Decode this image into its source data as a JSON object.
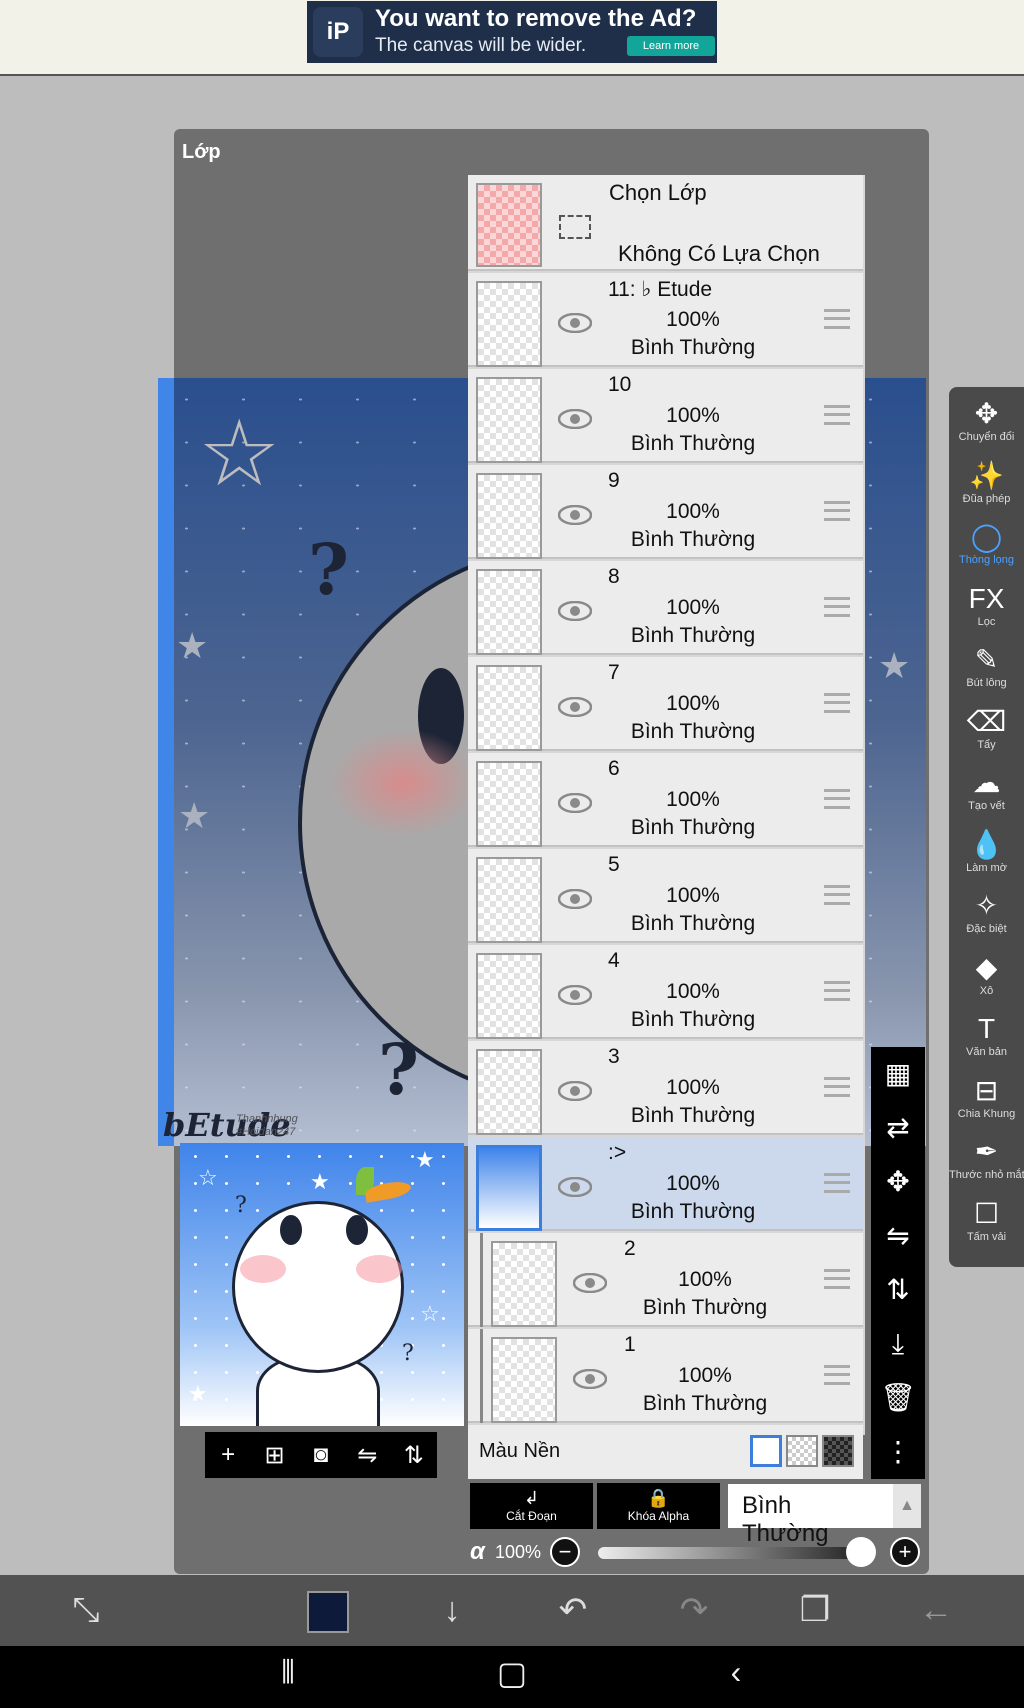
{
  "ad": {
    "line1": "You want to remove the Ad?",
    "line2": "The canvas will be wider.",
    "learn_more": "Learn more",
    "logo_text": "iP"
  },
  "panel": {
    "title": "Lớp"
  },
  "canvas": {
    "signature": "bEtude",
    "credit_line1": "Thanhnhung",
    "credit_line2": "#Hoidan247"
  },
  "selection_layer": {
    "title": "Chọn Lớp",
    "status": "Không Có Lựa Chọn"
  },
  "layers": [
    {
      "name": "11: ♭ Etude",
      "opacity": "100%",
      "mode": "Bình Thường"
    },
    {
      "name": "10",
      "opacity": "100%",
      "mode": "Bình Thường"
    },
    {
      "name": "9",
      "opacity": "100%",
      "mode": "Bình Thường"
    },
    {
      "name": "8",
      "opacity": "100%",
      "mode": "Bình Thường"
    },
    {
      "name": "7",
      "opacity": "100%",
      "mode": "Bình Thường"
    },
    {
      "name": "6",
      "opacity": "100%",
      "mode": "Bình Thường"
    },
    {
      "name": "5",
      "opacity": "100%",
      "mode": "Bình Thường"
    },
    {
      "name": "4",
      "opacity": "100%",
      "mode": "Bình Thường"
    },
    {
      "name": "3",
      "opacity": "100%",
      "mode": "Bình Thường"
    },
    {
      "name": ":>",
      "opacity": "100%",
      "mode": "Bình Thường",
      "selected": true
    },
    {
      "name": "2",
      "opacity": "100%",
      "mode": "Bình Thường"
    },
    {
      "name": "1",
      "opacity": "100%",
      "mode": "Bình Thường"
    }
  ],
  "background_row": {
    "label": "Màu Nền"
  },
  "blend": {
    "clip_label": "Cắt Đoạn",
    "alpha_lock_label": "Khóa Alpha",
    "mode": "Bình Thường"
  },
  "alpha": {
    "symbol": "α",
    "value": "100%"
  },
  "tools": [
    {
      "label": "Chuyển đổi",
      "icon": "move-icon"
    },
    {
      "label": "Đũa phép",
      "icon": "magic-wand-icon"
    },
    {
      "label": "Thòng lọng",
      "icon": "lasso-icon",
      "active": true
    },
    {
      "label": "Lọc",
      "icon": "fx-icon"
    },
    {
      "label": "Bút lông",
      "icon": "brush-icon"
    },
    {
      "label": "Tẩy",
      "icon": "eraser-icon"
    },
    {
      "label": "Tạo vết",
      "icon": "smudge-icon"
    },
    {
      "label": "Làm mờ",
      "icon": "blur-icon"
    },
    {
      "label": "Đặc biệt",
      "icon": "special-icon"
    },
    {
      "label": "Xô",
      "icon": "bucket-icon"
    },
    {
      "label": "Văn bản",
      "icon": "text-icon"
    },
    {
      "label": "Chia Khung",
      "icon": "frame-divider-icon"
    },
    {
      "label": "Thước nhỏ mắt",
      "icon": "eyedropper-icon"
    },
    {
      "label": "Tấm vải",
      "icon": "canvas-icon"
    }
  ],
  "colors": {
    "accent": "#4ba1ff",
    "current_color": "#0d1a3a",
    "selected_row": "#ccd8ec"
  }
}
